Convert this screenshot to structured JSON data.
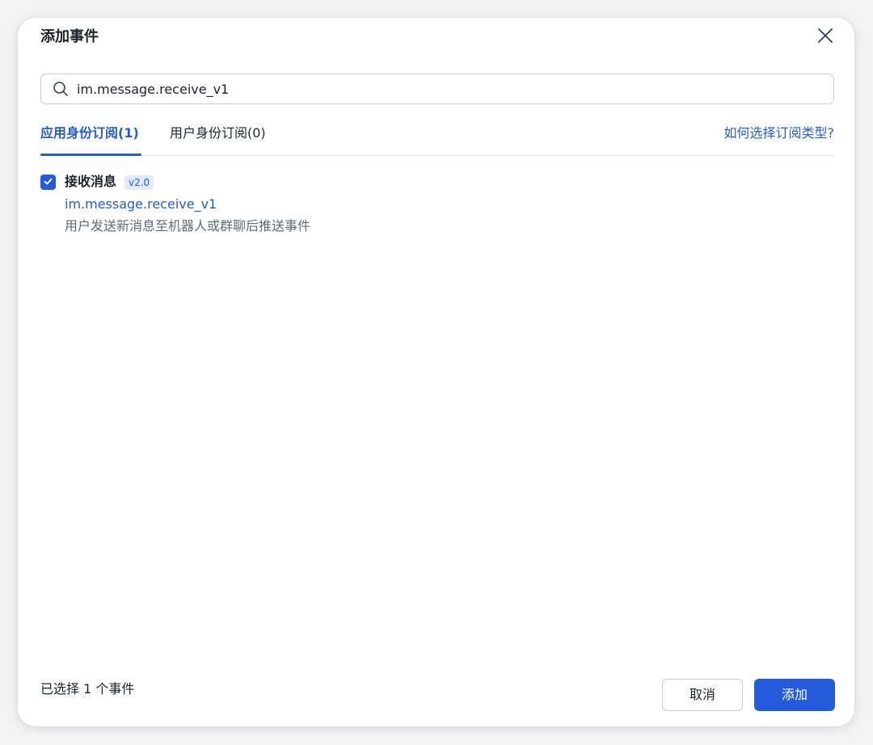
{
  "dialog": {
    "title": "添加事件",
    "close_icon": "close-icon"
  },
  "search": {
    "value": "im.message.receive_v1",
    "icon": "search-icon"
  },
  "tabs": [
    {
      "label": "应用身份订阅(1)",
      "active": true
    },
    {
      "label": "用户身份订阅(0)",
      "active": false
    }
  ],
  "help_link": "如何选择订阅类型?",
  "events": [
    {
      "checked": true,
      "name": "接收消息",
      "version": "v2.0",
      "key": "im.message.receive_v1",
      "description": "用户发送新消息至机器人或群聊后推送事件"
    }
  ],
  "footer": {
    "selected_count_text": "已选择 1 个事件",
    "cancel_label": "取消",
    "add_label": "添加"
  },
  "colors": {
    "accent": "#245bdb",
    "text": "#1f2329",
    "secondary_text": "#646a73",
    "badge_bg": "#e1eaff"
  }
}
